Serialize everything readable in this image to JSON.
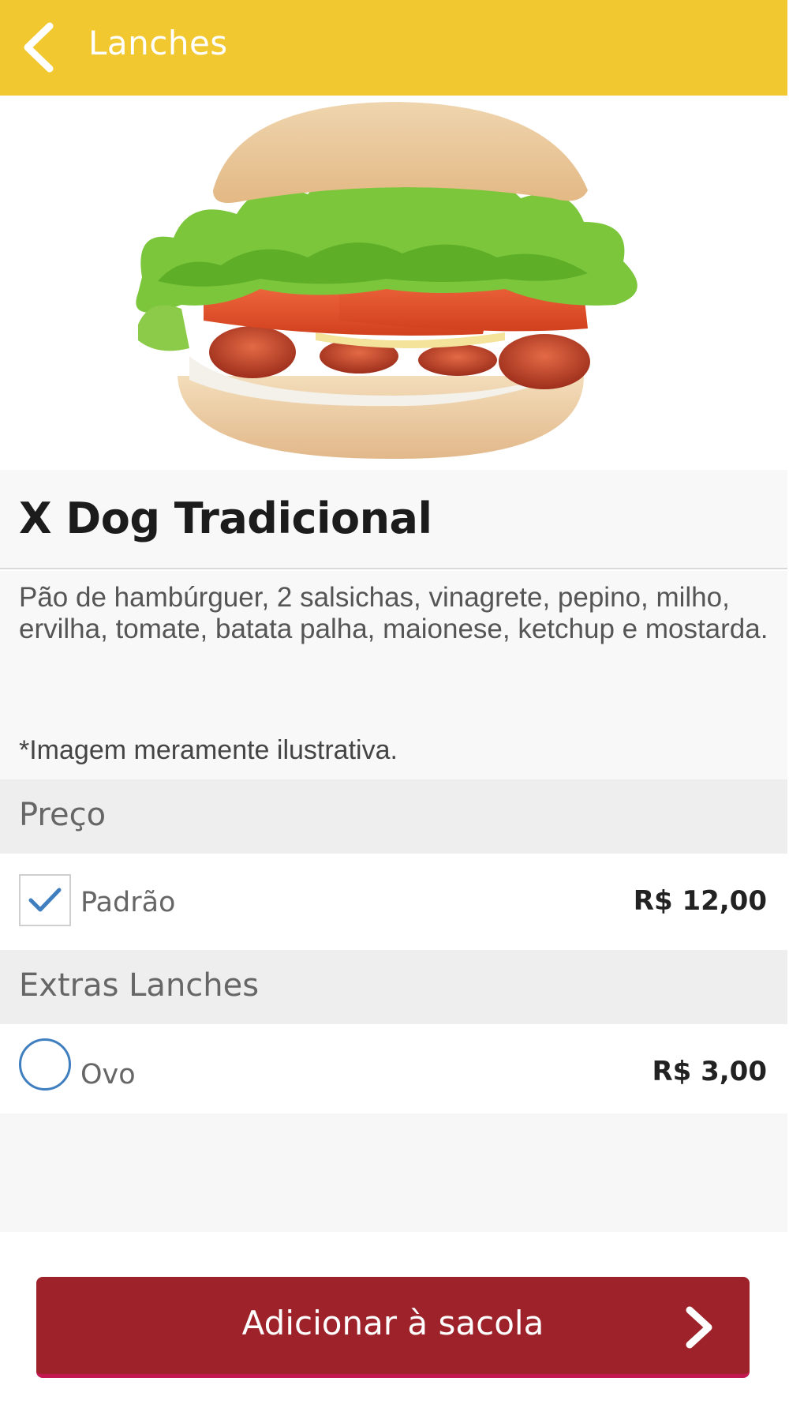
{
  "header": {
    "title": "Lanches",
    "back_icon": "chevron-left-icon"
  },
  "colors": {
    "header_bg": "#F2C830",
    "button_bg": "#9E2229",
    "accent_blue": "#3F7FBF"
  },
  "product": {
    "name": "X Dog Tradicional",
    "description": "Pão de hambúrguer, 2 salsichas, vinagrete, pepino, milho, ervilha, tomate, batata palha, maionese, ketchup e mostarda.",
    "disclaimer": "*Imagem meramente ilustrativa."
  },
  "sections": [
    {
      "title": "Preço",
      "options": [
        {
          "label": "Padrão",
          "price": "R$ 12,00",
          "selected": true,
          "control": "checkbox"
        }
      ]
    },
    {
      "title": "Extras Lanches",
      "options": [
        {
          "label": "Ovo",
          "price": "R$ 3,00",
          "selected": false,
          "control": "radio"
        }
      ]
    }
  ],
  "cta": {
    "label": "Adicionar à sacola",
    "icon": "chevron-right-icon"
  }
}
